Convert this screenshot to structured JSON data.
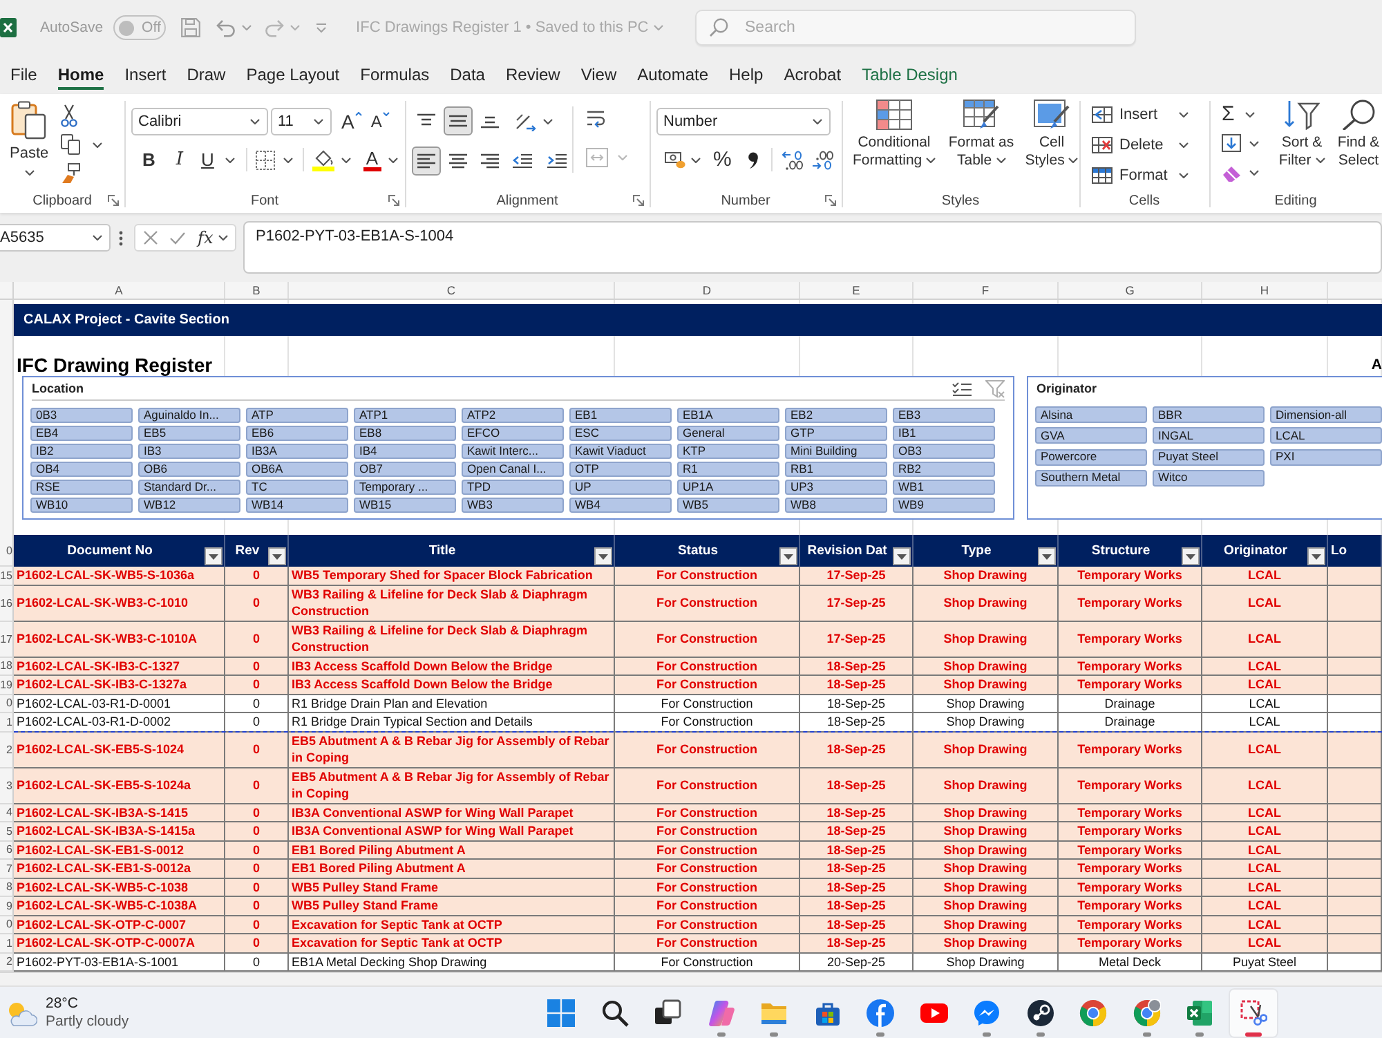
{
  "titlebar": {
    "autosave_label": "AutoSave",
    "autosave": {
      "on": false,
      "label": "Off"
    },
    "title": "IFC Drawings Register 1 • Saved to this PC",
    "search": {
      "placeholder": "Search"
    }
  },
  "menu": {
    "tabs": [
      {
        "label": "File",
        "selected": false,
        "kind": "standard"
      },
      {
        "label": "Home",
        "selected": true,
        "kind": "standard"
      },
      {
        "label": "Insert",
        "selected": false,
        "kind": "standard"
      },
      {
        "label": "Draw",
        "selected": false,
        "kind": "standard"
      },
      {
        "label": "Page Layout",
        "selected": false,
        "kind": "standard"
      },
      {
        "label": "Formulas",
        "selected": false,
        "kind": "standard"
      },
      {
        "label": "Data",
        "selected": false,
        "kind": "standard"
      },
      {
        "label": "Review",
        "selected": false,
        "kind": "standard"
      },
      {
        "label": "View",
        "selected": false,
        "kind": "standard"
      },
      {
        "label": "Automate",
        "selected": false,
        "kind": "standard"
      },
      {
        "label": "Help",
        "selected": false,
        "kind": "standard"
      },
      {
        "label": "Acrobat",
        "selected": false,
        "kind": "standard"
      },
      {
        "label": "Table Design",
        "selected": false,
        "kind": "contextual"
      }
    ]
  },
  "ribbon": {
    "groups": [
      {
        "kind": "clipboard",
        "label": "Clipboard",
        "paste": "Paste"
      },
      {
        "kind": "font",
        "label": "Font",
        "font_name": "Calibri",
        "font_size": "11",
        "grow": "A",
        "shrink": "A",
        "bold": "B",
        "italic": "I",
        "underline": "U",
        "font_color": "A"
      },
      {
        "kind": "alignment",
        "label": "Alignment",
        "vertical": [
          {
            "kind": "top",
            "selected": false
          },
          {
            "kind": "middle",
            "selected": true
          },
          {
            "kind": "bottom",
            "selected": false
          }
        ],
        "horizontal": [
          {
            "kind": "left",
            "selected": true
          },
          {
            "kind": "center",
            "selected": false
          },
          {
            "kind": "right",
            "selected": false
          }
        ],
        "merge": {
          "disabled": true
        }
      },
      {
        "kind": "number",
        "label": "Number",
        "format": "Number",
        "percent": "%"
      },
      {
        "kind": "styles",
        "label": "Styles",
        "buttons": [
          {
            "kind": "conditional",
            "label": "Conditional Formatting"
          },
          {
            "kind": "table",
            "label": "Format as Table"
          },
          {
            "kind": "cell",
            "label": "Cell Styles"
          }
        ]
      },
      {
        "kind": "cells",
        "label": "Cells",
        "buttons": [
          {
            "kind": "insert",
            "label": "Insert"
          },
          {
            "kind": "delete",
            "label": "Delete"
          },
          {
            "kind": "format",
            "label": "Format"
          }
        ]
      },
      {
        "kind": "editing",
        "label": "Editing",
        "autosum": "Σ",
        "buttons": [
          {
            "kind": "sort",
            "label": "Sort & Filter",
            "caret": true
          },
          {
            "kind": "find",
            "label": "Find & Select",
            "caret": false
          }
        ]
      }
    ]
  },
  "formula_bar": {
    "name_box": "A5635",
    "function_button": "fx",
    "formula": "P1602-PYT-03-EB1A-S-1004"
  },
  "sheet": {
    "column_letters": [
      "A",
      "B",
      "C",
      "D",
      "E",
      "F",
      "G",
      "H"
    ],
    "banner": "CALAX Project - Cavite Section",
    "heading": "IFC Drawing Register",
    "edge_text": "A",
    "slicers": [
      {
        "kind": "location",
        "title": "Location",
        "items": [
          {
            "label": "0B3",
            "selected": true
          },
          {
            "label": "Aguinaldo In...",
            "selected": true
          },
          {
            "label": "ATP",
            "selected": true
          },
          {
            "label": "ATP1",
            "selected": true
          },
          {
            "label": "ATP2",
            "selected": true
          },
          {
            "label": "EB1",
            "selected": true
          },
          {
            "label": "EB1A",
            "selected": true
          },
          {
            "label": "EB2",
            "selected": true
          },
          {
            "label": "EB3",
            "selected": true
          },
          {
            "label": "EB4",
            "selected": true
          },
          {
            "label": "EB5",
            "selected": true
          },
          {
            "label": "EB6",
            "selected": true
          },
          {
            "label": "EB8",
            "selected": true
          },
          {
            "label": "EFCO",
            "selected": true
          },
          {
            "label": "ESC",
            "selected": true
          },
          {
            "label": "General",
            "selected": true
          },
          {
            "label": "GTP",
            "selected": true
          },
          {
            "label": "IB1",
            "selected": true
          },
          {
            "label": "IB2",
            "selected": true
          },
          {
            "label": "IB3",
            "selected": true
          },
          {
            "label": "IB3A",
            "selected": true
          },
          {
            "label": "IB4",
            "selected": true
          },
          {
            "label": "Kawit Interc...",
            "selected": true
          },
          {
            "label": "Kawit Viaduct",
            "selected": true
          },
          {
            "label": "KTP",
            "selected": true
          },
          {
            "label": "Mini Building",
            "selected": true
          },
          {
            "label": "OB3",
            "selected": true
          },
          {
            "label": "OB4",
            "selected": true
          },
          {
            "label": "OB6",
            "selected": true
          },
          {
            "label": "OB6A",
            "selected": true
          },
          {
            "label": "OB7",
            "selected": true
          },
          {
            "label": "Open Canal I...",
            "selected": true
          },
          {
            "label": "OTP",
            "selected": true
          },
          {
            "label": "R1",
            "selected": true
          },
          {
            "label": "RB1",
            "selected": true
          },
          {
            "label": "RB2",
            "selected": true
          },
          {
            "label": "RSE",
            "selected": true
          },
          {
            "label": "Standard Dr...",
            "selected": true
          },
          {
            "label": "TC",
            "selected": true
          },
          {
            "label": "Temporary ...",
            "selected": true
          },
          {
            "label": "TPD",
            "selected": true
          },
          {
            "label": "UP",
            "selected": true
          },
          {
            "label": "UP1A",
            "selected": true
          },
          {
            "label": "UP3",
            "selected": true
          },
          {
            "label": "WB1",
            "selected": true
          },
          {
            "label": "WB10",
            "selected": true
          },
          {
            "label": "WB12",
            "selected": true
          },
          {
            "label": "WB14",
            "selected": true
          },
          {
            "label": "WB15",
            "selected": true
          },
          {
            "label": "WB3",
            "selected": true
          },
          {
            "label": "WB4",
            "selected": true
          },
          {
            "label": "WB5",
            "selected": true
          },
          {
            "label": "WB8",
            "selected": true
          },
          {
            "label": "WB9",
            "selected": true
          }
        ]
      },
      {
        "kind": "originator",
        "title": "Originator",
        "items": [
          {
            "label": "Alsina",
            "selected": true
          },
          {
            "label": "BBR",
            "selected": true
          },
          {
            "label": "Dimension-all",
            "selected": true
          },
          {
            "label": "GVA",
            "selected": true
          },
          {
            "label": "INGAL",
            "selected": true
          },
          {
            "label": "LCAL",
            "selected": true
          },
          {
            "label": "Powercore",
            "selected": true
          },
          {
            "label": "Puyat Steel",
            "selected": true
          },
          {
            "label": "PXI",
            "selected": true
          },
          {
            "label": "Southern Metal",
            "selected": true
          },
          {
            "label": "Witco",
            "selected": true
          }
        ]
      }
    ],
    "table": {
      "header_row_number": "0",
      "columns": [
        {
          "label": "Document No",
          "filter": true
        },
        {
          "label": "Rev",
          "filter": true
        },
        {
          "label": "Title",
          "filter": true
        },
        {
          "label": "Status",
          "filter": true
        },
        {
          "label": "Revision Dat",
          "filter": true
        },
        {
          "label": "Type",
          "filter": true
        },
        {
          "label": "Structure",
          "filter": true
        },
        {
          "label": "Originator",
          "filter": true
        },
        {
          "label": "Lo",
          "filter": false
        }
      ],
      "rows": [
        {
          "row_number": "15",
          "highlighted": true,
          "page_break": false,
          "cells": [
            "P1602-LCAL-SK-WB5-S-1036a",
            "0",
            "WB5 Temporary Shed for Spacer Block Fabrication",
            "For Construction",
            "17-Sep-25",
            "Shop Drawing",
            "Temporary Works",
            "LCAL"
          ]
        },
        {
          "row_number": "16",
          "highlighted": true,
          "page_break": false,
          "cells": [
            "P1602-LCAL-SK-WB3-C-1010",
            "0",
            "WB3 Railing & Lifeline for Deck Slab & Diaphragm Construction",
            "For Construction",
            "17-Sep-25",
            "Shop Drawing",
            "Temporary Works",
            "LCAL"
          ]
        },
        {
          "row_number": "17",
          "highlighted": true,
          "page_break": false,
          "cells": [
            "P1602-LCAL-SK-WB3-C-1010A",
            "0",
            "WB3 Railing & Lifeline for Deck Slab & Diaphragm Construction",
            "For Construction",
            "17-Sep-25",
            "Shop Drawing",
            "Temporary Works",
            "LCAL"
          ]
        },
        {
          "row_number": "18",
          "highlighted": true,
          "page_break": false,
          "cells": [
            "P1602-LCAL-SK-IB3-C-1327",
            "0",
            "IB3 Access Scaffold Down Below the Bridge",
            "For Construction",
            "18-Sep-25",
            "Shop Drawing",
            "Temporary Works",
            "LCAL"
          ]
        },
        {
          "row_number": "19",
          "highlighted": true,
          "page_break": false,
          "cells": [
            "P1602-LCAL-SK-IB3-C-1327a",
            "0",
            "IB3 Access Scaffold Down Below the Bridge",
            "For Construction",
            "18-Sep-25",
            "Shop Drawing",
            "Temporary Works",
            "LCAL"
          ]
        },
        {
          "row_number": "0",
          "highlighted": false,
          "page_break": false,
          "cells": [
            "P1602-LCAL-03-R1-D-0001",
            "0",
            "R1 Bridge Drain Plan and Elevation",
            "For Construction",
            "18-Sep-25",
            "Shop Drawing",
            "Drainage",
            "LCAL"
          ]
        },
        {
          "row_number": "1",
          "highlighted": false,
          "page_break": true,
          "cells": [
            "P1602-LCAL-03-R1-D-0002",
            "0",
            "R1 Bridge Drain Typical Section and Details",
            "For Construction",
            "18-Sep-25",
            "Shop Drawing",
            "Drainage",
            "LCAL"
          ]
        },
        {
          "row_number": "2",
          "highlighted": true,
          "page_break": false,
          "cells": [
            "P1602-LCAL-SK-EB5-S-1024",
            "0",
            "EB5 Abutment A & B Rebar Jig for Assembly of Rebar in Coping",
            "For Construction",
            "18-Sep-25",
            "Shop Drawing",
            "Temporary Works",
            "LCAL"
          ]
        },
        {
          "row_number": "3",
          "highlighted": true,
          "page_break": false,
          "cells": [
            "P1602-LCAL-SK-EB5-S-1024a",
            "0",
            "EB5 Abutment A & B Rebar Jig for Assembly of Rebar in Coping",
            "For Construction",
            "18-Sep-25",
            "Shop Drawing",
            "Temporary Works",
            "LCAL"
          ]
        },
        {
          "row_number": "4",
          "highlighted": true,
          "page_break": false,
          "cells": [
            "P1602-LCAL-SK-IB3A-S-1415",
            "0",
            "IB3A Conventional ASWP for Wing Wall Parapet",
            "For Construction",
            "18-Sep-25",
            "Shop Drawing",
            "Temporary Works",
            "LCAL"
          ]
        },
        {
          "row_number": "5",
          "highlighted": true,
          "page_break": false,
          "cells": [
            "P1602-LCAL-SK-IB3A-S-1415a",
            "0",
            "IB3A Conventional ASWP for Wing Wall Parapet",
            "For Construction",
            "18-Sep-25",
            "Shop Drawing",
            "Temporary Works",
            "LCAL"
          ]
        },
        {
          "row_number": "6",
          "highlighted": true,
          "page_break": false,
          "cells": [
            "P1602-LCAL-SK-EB1-S-0012",
            "0",
            "EB1 Bored Piling Abutment A",
            "For Construction",
            "18-Sep-25",
            "Shop Drawing",
            "Temporary Works",
            "LCAL"
          ]
        },
        {
          "row_number": "7",
          "highlighted": true,
          "page_break": false,
          "cells": [
            "P1602-LCAL-SK-EB1-S-0012a",
            "0",
            "EB1 Bored Piling Abutment A",
            "For Construction",
            "18-Sep-25",
            "Shop Drawing",
            "Temporary Works",
            "LCAL"
          ]
        },
        {
          "row_number": "8",
          "highlighted": true,
          "page_break": false,
          "cells": [
            "P1602-LCAL-SK-WB5-C-1038",
            "0",
            "WB5 Pulley Stand Frame",
            "For Construction",
            "18-Sep-25",
            "Shop Drawing",
            "Temporary Works",
            "LCAL"
          ]
        },
        {
          "row_number": "9",
          "highlighted": true,
          "page_break": false,
          "cells": [
            "P1602-LCAL-SK-WB5-C-1038A",
            "0",
            "WB5 Pulley Stand Frame",
            "For Construction",
            "18-Sep-25",
            "Shop Drawing",
            "Temporary Works",
            "LCAL"
          ]
        },
        {
          "row_number": "0",
          "highlighted": true,
          "page_break": false,
          "cells": [
            "P1602-LCAL-SK-OTP-C-0007",
            "0",
            "Excavation for Septic Tank at OCTP",
            "For Construction",
            "18-Sep-25",
            "Shop Drawing",
            "Temporary Works",
            "LCAL"
          ]
        },
        {
          "row_number": "1",
          "highlighted": true,
          "page_break": false,
          "cells": [
            "P1602-LCAL-SK-OTP-C-0007A",
            "0",
            "Excavation for Septic Tank at OCTP",
            "For Construction",
            "18-Sep-25",
            "Shop Drawing",
            "Temporary Works",
            "LCAL"
          ]
        },
        {
          "row_number": "2",
          "highlighted": false,
          "page_break": false,
          "cells": [
            "P1602-PYT-03-EB1A-S-1001",
            "0",
            "EB1A Metal Decking Shop Drawing",
            "For Construction",
            "20-Sep-25",
            "Shop Drawing",
            "Metal Deck",
            "Puyat Steel"
          ]
        }
      ]
    }
  },
  "taskbar": {
    "weather": {
      "temperature": "28°C",
      "condition": "Partly cloudy"
    },
    "apps": [
      {
        "kind": "start",
        "running": false,
        "selected": false
      },
      {
        "kind": "search",
        "running": false,
        "selected": false
      },
      {
        "kind": "task_view",
        "running": false,
        "selected": false
      },
      {
        "kind": "copilot",
        "running": true,
        "selected": false
      },
      {
        "kind": "explorer",
        "running": true,
        "selected": false
      },
      {
        "kind": "store",
        "running": false,
        "selected": false
      },
      {
        "kind": "facebook",
        "running": true,
        "selected": false
      },
      {
        "kind": "youtube",
        "running": false,
        "selected": false
      },
      {
        "kind": "messenger",
        "running": true,
        "selected": false
      },
      {
        "kind": "steam",
        "running": true,
        "selected": false
      },
      {
        "kind": "chrome",
        "running": false,
        "selected": false
      },
      {
        "kind": "chrome_profile",
        "running": true,
        "selected": false
      },
      {
        "kind": "excel",
        "running": true,
        "selected": false
      },
      {
        "kind": "snipping",
        "running": true,
        "selected": true
      }
    ]
  }
}
